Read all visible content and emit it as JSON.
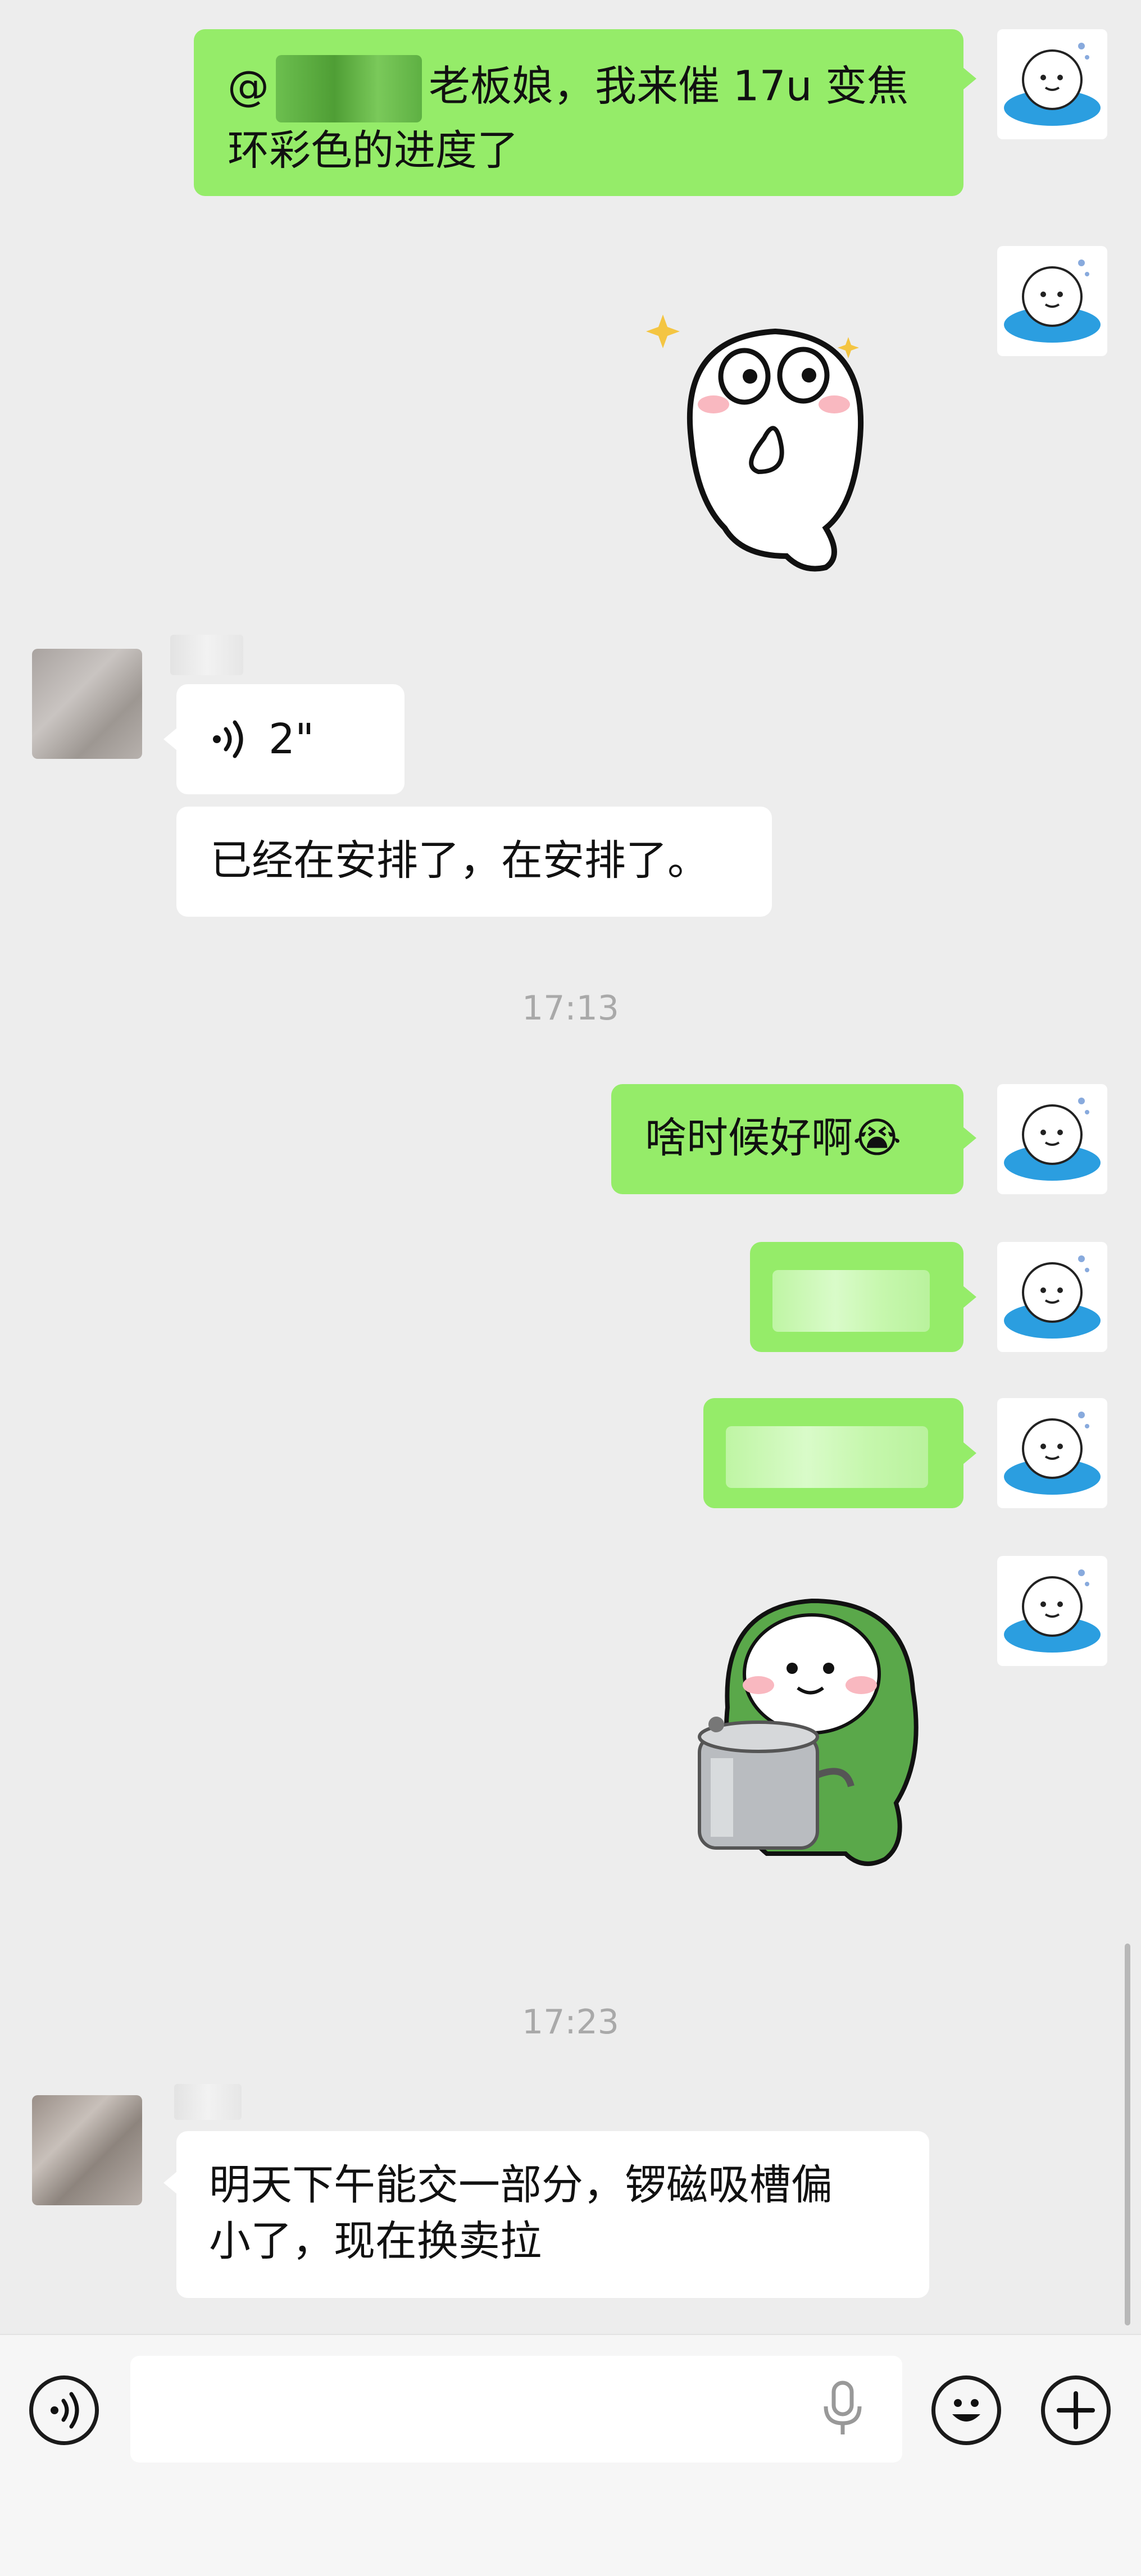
{
  "messages": {
    "m1": {
      "prefix": "@",
      "text": "老板娘，我来催 17u 变焦",
      "line2": "环彩色的进度了"
    },
    "voice": {
      "duration": "2\""
    },
    "m3": {
      "text": "已经在安排了，在安排了。"
    },
    "time1": "17:13",
    "m4": {
      "text": "啥时候好啊",
      "emoji": "😭"
    },
    "time2": "17:23",
    "m5": {
      "line1": "明天下午能交一部分，锣磁吸槽偏",
      "line2": "小了，现在换卖拉"
    }
  },
  "colors": {
    "self_bubble": "#95ec69",
    "other_bubble": "#ffffff",
    "background": "#ededed"
  },
  "icons": {
    "voice_toggle": "voice-icon",
    "mic": "microphone-icon",
    "emoji": "emoji-icon",
    "more": "plus-icon"
  }
}
